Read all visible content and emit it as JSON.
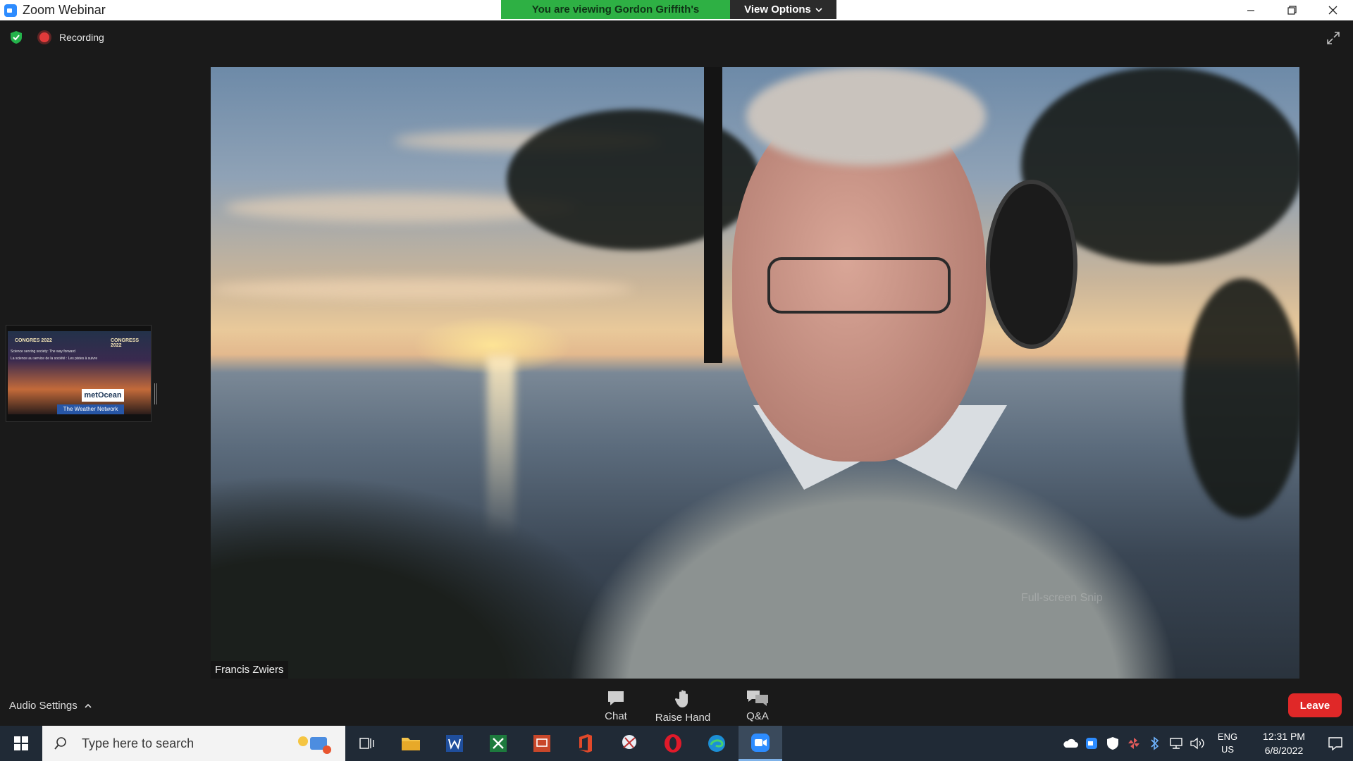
{
  "window": {
    "title": "Zoom Webinar",
    "share_banner": "You are viewing Gordon Griffith's screen",
    "view_options": "View Options"
  },
  "status": {
    "recording_label": "Recording"
  },
  "video": {
    "participant_name": "Francis Zwiers",
    "fullscreen_hint": "Full-screen Snip"
  },
  "thumbnail": {
    "heading_left": "CONGRES 2022",
    "heading_right": "CONGRESS 2022",
    "line1": "Science serving society: The way forward",
    "line2": "La science au service de la société : Les pistes à suivre",
    "sponsor1": "metOcean",
    "sponsor2": "The Weather Network"
  },
  "toolbar": {
    "audio_settings": "Audio Settings",
    "chat": "Chat",
    "raise_hand": "Raise Hand",
    "qa": "Q&A",
    "leave": "Leave"
  },
  "taskbar": {
    "search_placeholder": "Type here to search",
    "lang_line1": "ENG",
    "lang_line2": "US",
    "time": "12:31 PM",
    "date": "6/8/2022"
  },
  "colors": {
    "share_green": "#2eb044",
    "leave_red": "#e02828",
    "zoom_blue": "#2d8cff"
  }
}
